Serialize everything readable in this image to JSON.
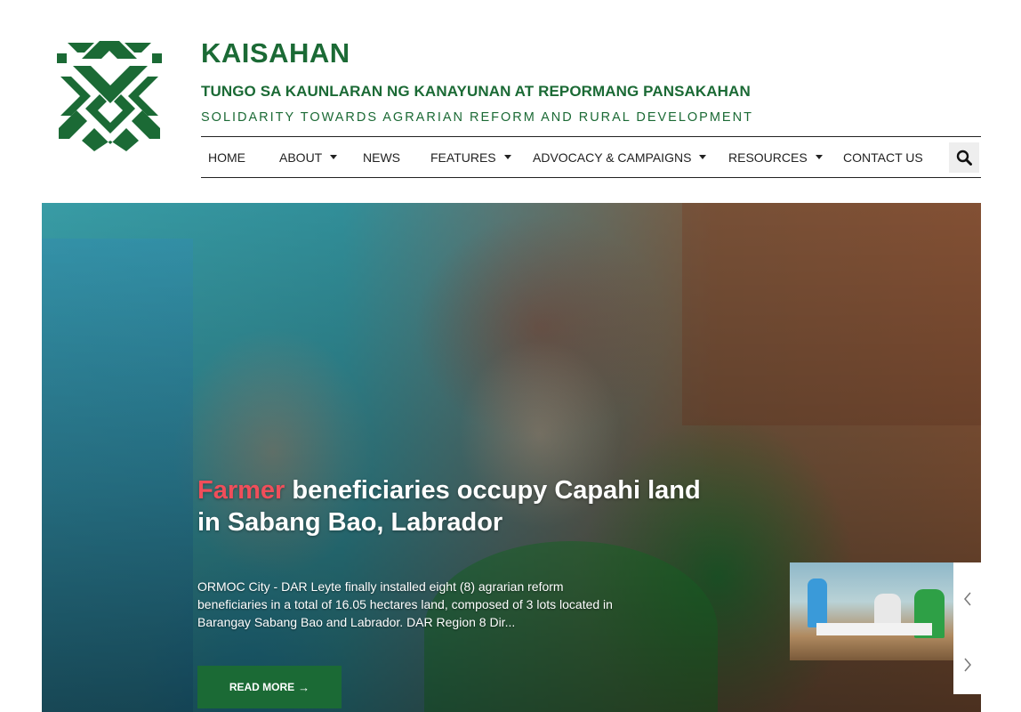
{
  "brand": {
    "title": "KAISAHAN",
    "tagline": "TUNGO SA KAUNLARAN NG KANAYUNAN AT REPORMANG PANSAKAHAN",
    "subtagline": "SOLIDARITY TOWARDS AGRARIAN REFORM AND RURAL DEVELOPMENT",
    "logo_icon": "kaisahan-logo",
    "color": "#1b6a35"
  },
  "nav": {
    "items": [
      {
        "label": "HOME",
        "has_dropdown": false
      },
      {
        "label": "ABOUT",
        "has_dropdown": true
      },
      {
        "label": "NEWS",
        "has_dropdown": false
      },
      {
        "label": "FEATURES",
        "has_dropdown": true
      },
      {
        "label": "ADVOCACY & CAMPAIGNS",
        "has_dropdown": true
      },
      {
        "label": "RESOURCES",
        "has_dropdown": true
      },
      {
        "label": "CONTACT US",
        "has_dropdown": false
      }
    ],
    "search_icon": "search-icon"
  },
  "hero": {
    "headline_accent": "Farmer",
    "headline_rest": " beneficiaries occupy Capahi land in Sabang Bao, Labrador",
    "summary": "ORMOC City - DAR Leyte finally installed eight (8) agrarian reform beneficiaries in a total of 16.05 hectares land, composed of 3 lots located in Barangay Sabang Bao and Labrador. DAR Region 8 Dir...",
    "read_more_label": "READ MORE",
    "read_more_icon": "arrow-right-icon",
    "accent_color": "#f04e5a"
  },
  "slider": {
    "prev_icon": "chevron-left-icon",
    "next_icon": "chevron-right-icon"
  }
}
